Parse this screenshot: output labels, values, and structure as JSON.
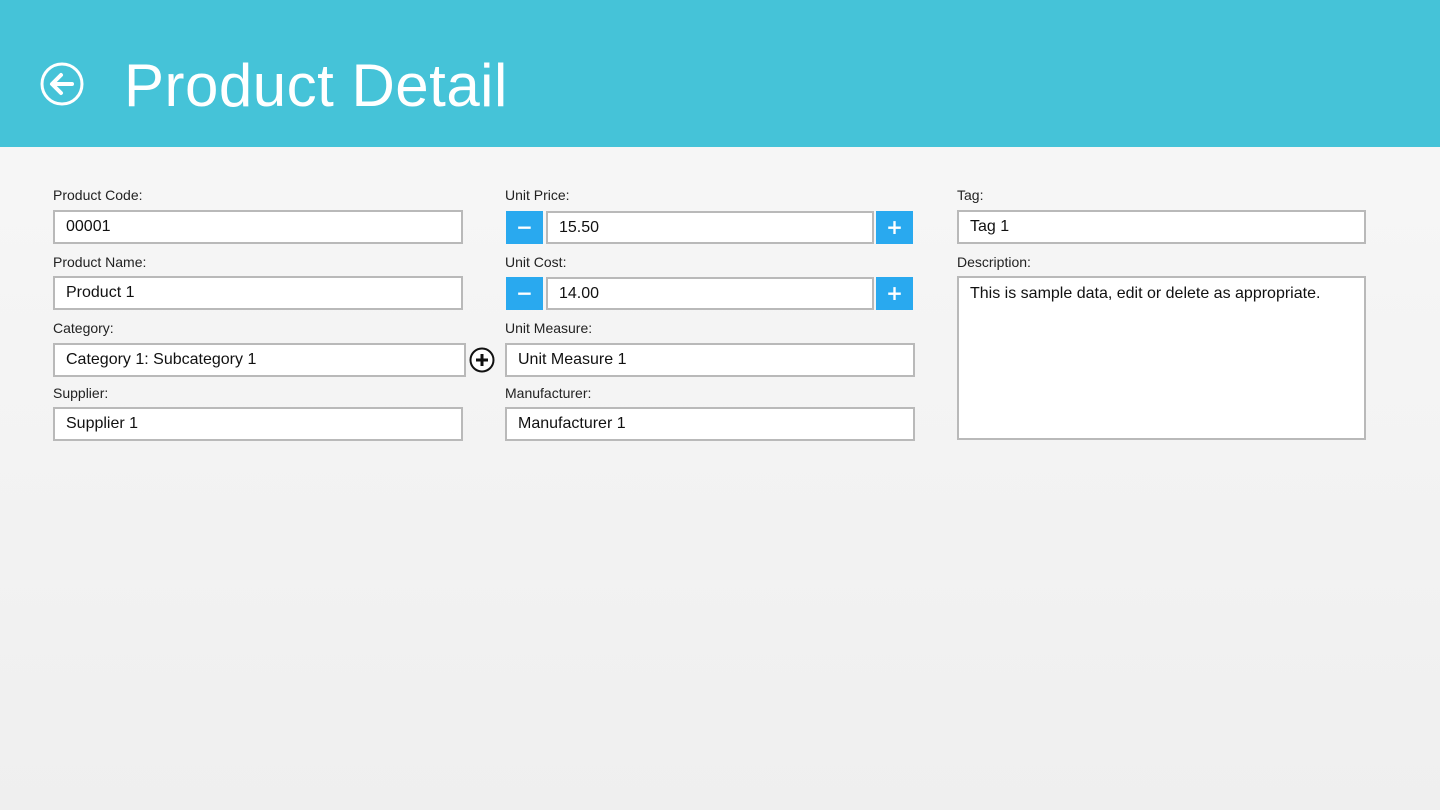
{
  "header": {
    "title": "Product Detail",
    "back_icon": "back-arrow-circle-icon",
    "background_color": "#45c3d8"
  },
  "form": {
    "product_code": {
      "label": "Product Code:",
      "value": "00001"
    },
    "product_name": {
      "label": "Product Name:",
      "value": "Product 1"
    },
    "category": {
      "label": "Category:",
      "value": "Category 1: Subcategory 1",
      "add_icon": "plus-circle-icon"
    },
    "supplier": {
      "label": "Supplier:",
      "value": "Supplier 1"
    },
    "unit_price": {
      "label": "Unit Price:",
      "value": "15.50",
      "decrement": "−",
      "increment": "+"
    },
    "unit_cost": {
      "label": "Unit Cost:",
      "value": "14.00",
      "decrement": "−",
      "increment": "+"
    },
    "unit_measure": {
      "label": "Unit Measure:",
      "value": "Unit Measure 1"
    },
    "manufacturer": {
      "label": "Manufacturer:",
      "value": "Manufacturer 1"
    },
    "tag": {
      "label": "Tag:",
      "value": "Tag 1"
    },
    "description": {
      "label": "Description:",
      "value": "This is sample data, edit or delete as appropriate."
    }
  },
  "colors": {
    "stepper_button": "#29a9ef",
    "field_border": "#b9b9b9"
  }
}
